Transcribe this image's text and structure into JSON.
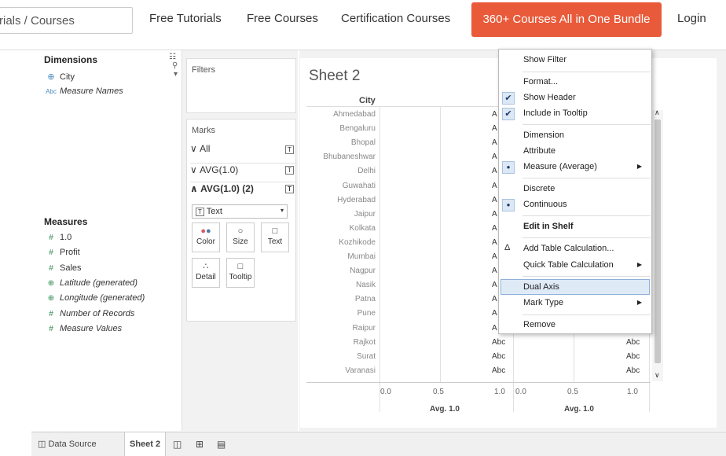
{
  "header": {
    "search_value": "rials / Courses",
    "nav": [
      "Free Tutorials",
      "Free Courses",
      "Certification Courses"
    ],
    "bundle_button": "360+ Courses All in One Bundle",
    "login": "Login"
  },
  "data_pane": {
    "dimensions_title": "Dimensions",
    "dimensions": [
      {
        "icon": "globe-icon",
        "label": "City",
        "italic": false
      },
      {
        "icon": "abc-icon",
        "label": "Measure Names",
        "italic": true
      }
    ],
    "measures_title": "Measures",
    "measures": [
      {
        "icon": "hash-icon",
        "label": "1.0",
        "italic": false
      },
      {
        "icon": "hash-icon",
        "label": "Profit",
        "italic": false
      },
      {
        "icon": "hash-icon",
        "label": "Sales",
        "italic": false
      },
      {
        "icon": "globe-icon",
        "label": "Latitude (generated)",
        "italic": true
      },
      {
        "icon": "globe-icon",
        "label": "Longitude (generated)",
        "italic": true
      },
      {
        "icon": "hash-icon",
        "label": "Number of Records",
        "italic": true
      },
      {
        "icon": "hash-icon",
        "label": "Measure Values",
        "italic": true
      }
    ]
  },
  "shelves": {
    "filters_label": "Filters",
    "marks_label": "Marks",
    "mark_rows": [
      "All",
      "AVG(1.0)",
      "AVG(1.0) (2)"
    ],
    "mark_type": "Text",
    "mark_buttons": [
      "Color",
      "Size",
      "Text",
      "Detail",
      "Tooltip"
    ]
  },
  "sheet": {
    "title": "Sheet 2",
    "column_header": "City",
    "cities": [
      "Ahmedabad",
      "Bengaluru",
      "Bhopal",
      "Bhubaneshwar",
      "Delhi",
      "Guwahati",
      "Hyderabad",
      "Jaipur",
      "Kolkata",
      "Kozhikode",
      "Mumbai",
      "Nagpur",
      "Nasik",
      "Patna",
      "Pune",
      "Raipur",
      "Rajkot",
      "Surat",
      "Varanasi"
    ],
    "cell_text_visible": "A",
    "cell_text_full": "Abc",
    "axis_ticks": [
      "0.0",
      "0.5",
      "1.0"
    ],
    "axis_title": "Avg. 1.0"
  },
  "context_menu": {
    "items": [
      {
        "label": "Show Filter",
        "bold": false,
        "mark": "",
        "submenu": false
      },
      {
        "label": "Format...",
        "bold": false,
        "mark": "",
        "submenu": false
      },
      {
        "label": "Show Header",
        "bold": false,
        "mark": "check",
        "submenu": false
      },
      {
        "label": "Include in Tooltip",
        "bold": false,
        "mark": "check",
        "submenu": false
      },
      {
        "label": "Dimension",
        "bold": false,
        "mark": "",
        "submenu": false
      },
      {
        "label": "Attribute",
        "bold": false,
        "mark": "",
        "submenu": false
      },
      {
        "label": "Measure (Average)",
        "bold": false,
        "mark": "dot",
        "submenu": true
      },
      {
        "label": "Discrete",
        "bold": false,
        "mark": "",
        "submenu": false
      },
      {
        "label": "Continuous",
        "bold": false,
        "mark": "dot",
        "submenu": false
      },
      {
        "label": "Edit in Shelf",
        "bold": true,
        "mark": "",
        "submenu": false
      },
      {
        "label": "Add Table Calculation...",
        "bold": false,
        "mark": "delta",
        "submenu": false
      },
      {
        "label": "Quick Table Calculation",
        "bold": false,
        "mark": "",
        "submenu": true
      },
      {
        "label": "Dual Axis",
        "bold": false,
        "mark": "",
        "submenu": false
      },
      {
        "label": "Mark Type",
        "bold": false,
        "mark": "",
        "submenu": true
      },
      {
        "label": "Remove",
        "bold": false,
        "mark": "",
        "submenu": false
      }
    ],
    "highlighted": "Dual Axis"
  },
  "bottom_tabs": {
    "data_source": "Data Source",
    "sheet": "Sheet 2"
  },
  "colors": {
    "accent": "#e85a3a",
    "measure_green": "#2d8a4e",
    "dimension_blue": "#4b8bbe",
    "menu_highlight": "#dfeaf7"
  }
}
